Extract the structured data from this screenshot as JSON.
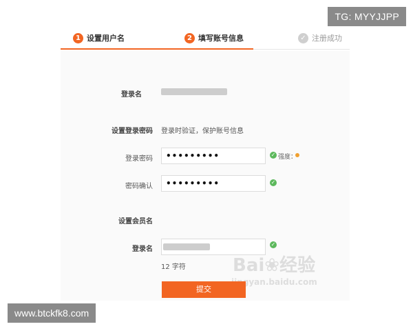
{
  "overlay": {
    "tag": "TG: MYYJJPP",
    "url": "www.btckfk8.com"
  },
  "steps": [
    {
      "num": "1",
      "label": "设置用户名",
      "state": "active"
    },
    {
      "num": "2",
      "label": "填写账号信息",
      "state": "active"
    },
    {
      "num": "✓",
      "label": "注册成功",
      "state": "done"
    }
  ],
  "form": {
    "login_label": "登录名",
    "set_password_label": "设置登录密码",
    "set_password_hint": "登录时验证，保护账号信息",
    "password_label": "登录密码",
    "password_value": "•••••••••",
    "strength_label": "强度：",
    "confirm_label": "密码确认",
    "confirm_value": "•••••••••",
    "member_section": "设置会员名",
    "member_login_label": "登录名",
    "char_count": "12 字符",
    "submit_label": "提交"
  },
  "watermark": {
    "brand": "Bai",
    "brand_cn": "经验",
    "url": "jingyan.baidu.com"
  },
  "colors": {
    "accent": "#f26522",
    "success": "#5cb85c"
  }
}
